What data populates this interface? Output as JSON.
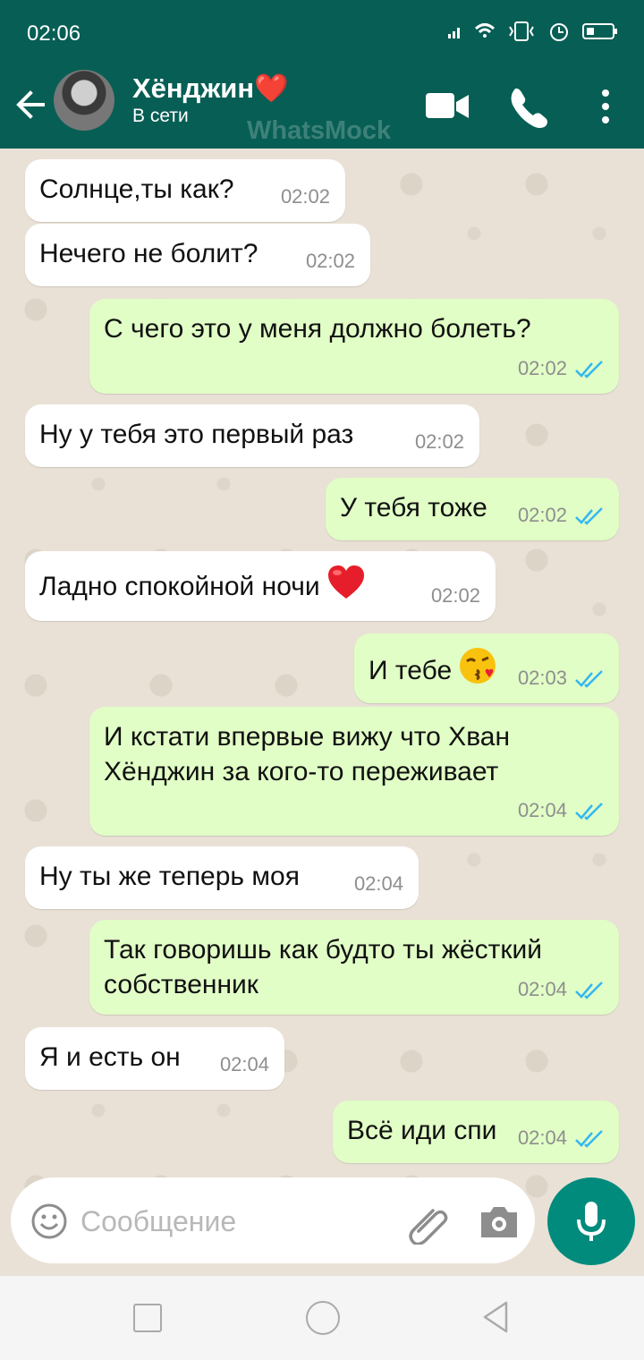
{
  "status_bar": {
    "time": "02:06"
  },
  "header": {
    "contact_name": "Хёнджин❤️",
    "contact_status": "В сети",
    "watermark": "WhatsMock"
  },
  "messages": [
    {
      "text": "Солнце,ты как?",
      "time": "02:02",
      "direction": "incoming"
    },
    {
      "text": "Нечего не болит?",
      "time": "02:02",
      "direction": "incoming"
    },
    {
      "text": "С чего это у меня должно болеть?",
      "time": "02:02",
      "direction": "outgoing",
      "read": true
    },
    {
      "text": "Ну у тебя это первый раз",
      "time": "02:02",
      "direction": "incoming"
    },
    {
      "text": "У тебя тоже",
      "time": "02:02",
      "direction": "outgoing",
      "read": true
    },
    {
      "text": "Ладно спокойной ночи",
      "time": "02:02",
      "direction": "incoming",
      "emoji": "red-heart"
    },
    {
      "text": "И тебе",
      "time": "02:03",
      "direction": "outgoing",
      "read": true,
      "emoji": "kiss-face"
    },
    {
      "text_lines": [
        "И кстати впервые вижу что Хван",
        "Хёнджин за кого-то переживает"
      ],
      "time": "02:04",
      "direction": "outgoing",
      "read": true
    },
    {
      "text": "Ну ты же теперь моя",
      "time": "02:04",
      "direction": "incoming"
    },
    {
      "text_lines": [
        "Так говоришь как будто ты жёсткий",
        "собственник"
      ],
      "time": "02:04",
      "direction": "outgoing",
      "read": true
    },
    {
      "text": "Я и есть он",
      "time": "02:04",
      "direction": "incoming"
    },
    {
      "text": "Всё иди спи",
      "time": "02:04",
      "direction": "outgoing",
      "read": true
    }
  ],
  "composer": {
    "placeholder": "Сообщение"
  },
  "colors": {
    "header": "#075e54",
    "chat_background": "#e9e1d6",
    "incoming_bubble": "#ffffff",
    "outgoing_bubble": "#e1fec6",
    "read_ticks": "#34b7f1",
    "mic_button": "#008b7d"
  },
  "icons": [
    "back-arrow-icon",
    "video-call-icon",
    "phone-icon",
    "more-options-icon",
    "emoji-icon",
    "attachment-icon",
    "camera-icon",
    "microphone-icon"
  ]
}
